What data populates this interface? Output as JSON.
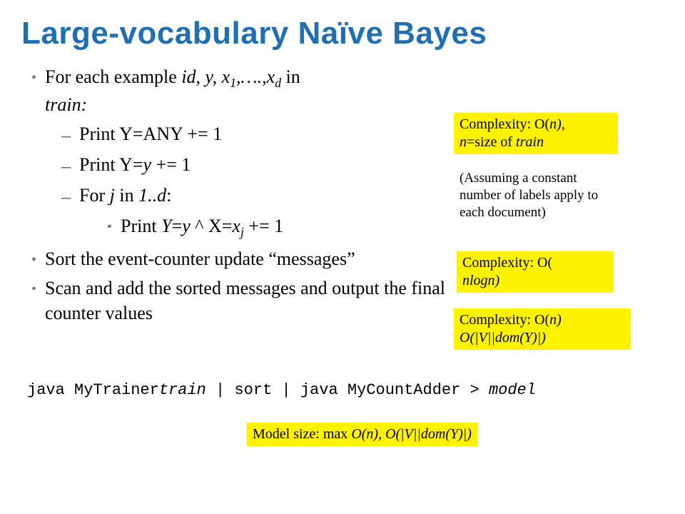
{
  "title": "Large-vocabulary Naïve Bayes",
  "bullets": {
    "b1": "For each example ",
    "b1_ital": "id, y, x",
    "b1_sub1": "1",
    "b1_mid": ",….,x",
    "b1_sub2": "d",
    "b1_tail": "  in ",
    "b1_train": "train:",
    "b2": "Print Y=ANY += 1",
    "b3a": "Print Y=",
    "b3b": "y",
    "b3c": " += 1",
    "b4a": "For ",
    "b4b": "j",
    "b4c": " in ",
    "b4d": "1..d",
    "b4e": ":",
    "b5a": "Print  ",
    "b5b": "Y",
    "b5c": "=",
    "b5d": "y",
    "b5e": " ^ X=",
    "b5f": "x",
    "b5g": "j",
    "b5h": " += 1",
    "b6": "Sort the event-counter update “messages”",
    "b7": "Scan and add the sorted messages and output the final counter values"
  },
  "notes": {
    "n1a": "Complexity: O(",
    "n1b": "n),",
    "n1c": "n",
    "n1d": "=size of ",
    "n1e": "train",
    "n2": "(Assuming a constant number of labels apply to each document)",
    "n3a": "Complexity: O(",
    "n3b": "nlogn)",
    "n4a": "Complexity: O(",
    "n4b": "n)",
    "n4c": "O(|V||dom(Y)|)",
    "n5a": "Model size:  max ",
    "n5b": "O(n), O(|V||dom(Y)|)"
  },
  "code": {
    "c1": "java MyTrainer",
    "c2": "train",
    "c3": " | sort | java MyCountAdder > ",
    "c4": "model"
  }
}
